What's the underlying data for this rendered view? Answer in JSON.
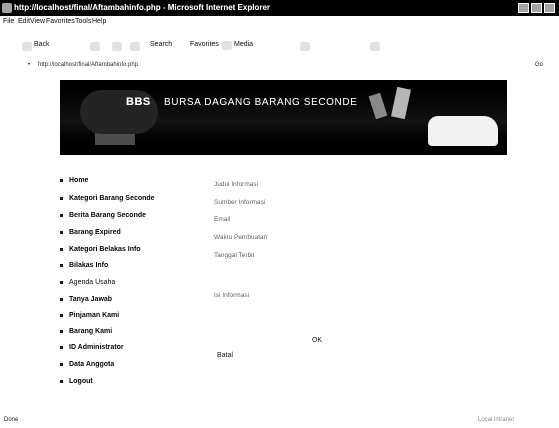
{
  "window": {
    "title": "http://localhost/final/Aftambahinfo.php - Microsoft Internet Explorer"
  },
  "menubar": {
    "items": [
      "File",
      "Edit",
      "View",
      "Favorites",
      "Tools",
      "Help"
    ]
  },
  "toolbar": {
    "back_label": "Back",
    "search_label": "Search",
    "favorites_label": "Favorites",
    "media_label": "Media"
  },
  "address": {
    "url": "http://localhost/final/Aftambahinfo.php",
    "go_label": "Go"
  },
  "banner": {
    "logo_text": "BBS",
    "title": "BURSA DAGANG BARANG SECONDE"
  },
  "menu": {
    "items": [
      "Home",
      "Kategori Barang Seconde",
      "Berita Barang Seconde",
      "Barang Expired",
      "Kategori Belakas Info",
      "Bilakas Info",
      "Agenda Usaha",
      "Tanya Jawab",
      "Pinjaman Kami",
      "Barang Kami",
      "ID Administrator",
      "Data Anggota",
      "Logout"
    ]
  },
  "form": {
    "labels": [
      "Judul Informasi",
      "Sumber Informasi",
      "Email",
      "Waktu Pembuatan",
      "Tanggal Terbit",
      "Isi Informasi"
    ],
    "ok_label": "OK",
    "reset_label": "Batal"
  },
  "status": {
    "done": "Done",
    "zone": "Local intranet"
  }
}
